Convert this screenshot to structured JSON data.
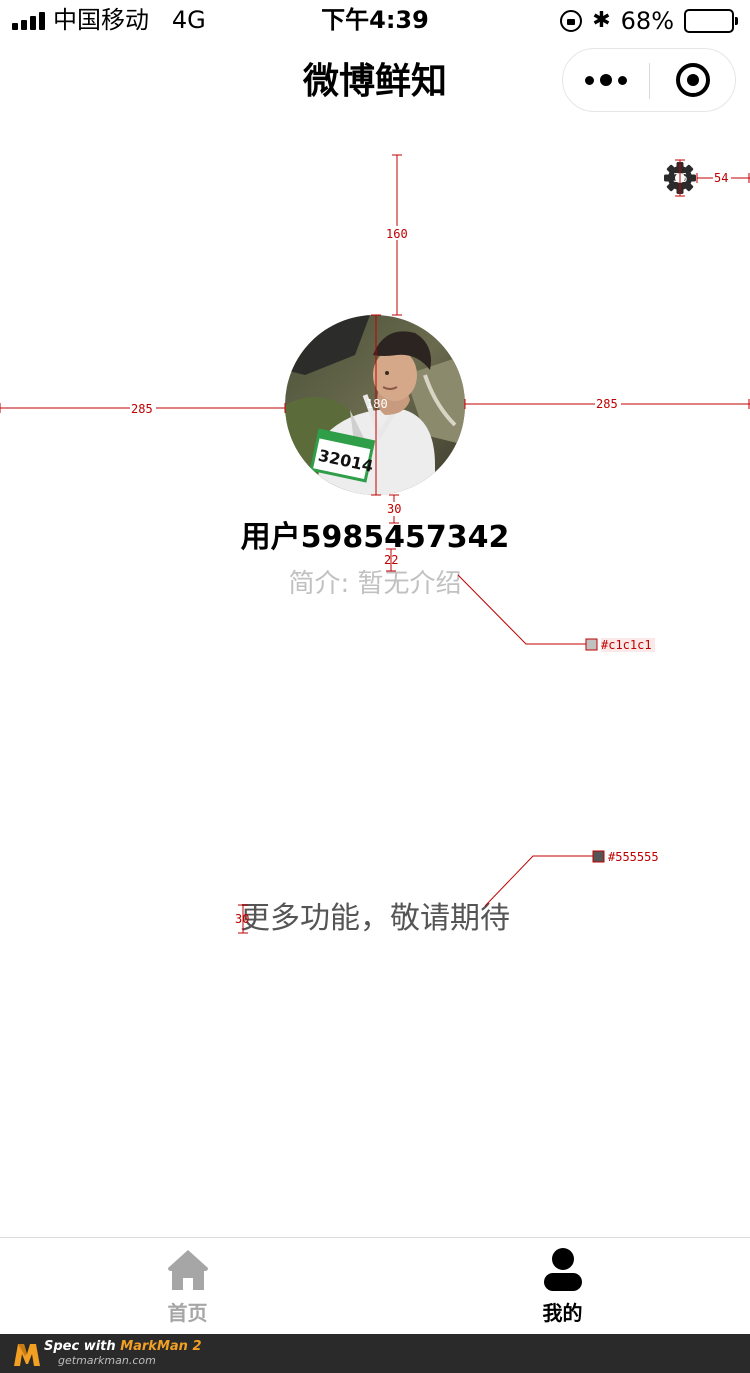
{
  "status_bar": {
    "carrier": "中国移动",
    "network": "4G",
    "time": "下午4:39",
    "battery_percent": "68%",
    "battery_level": 0.68,
    "icons": [
      "signal-icon",
      "rotation-lock-icon",
      "bluetooth-icon",
      "battery-icon"
    ]
  },
  "nav": {
    "title": "微博鲜知",
    "capsule_icons": [
      "more-icon",
      "close-miniprogram-icon"
    ]
  },
  "profile": {
    "username": "用户5985457342",
    "intro": "简介: 暂无介绍",
    "settings_icon": "gear-icon",
    "avatar": "user-avatar-photo",
    "intro_color": "#c1c1c1"
  },
  "main": {
    "more_features": "更多功能，敬请期待",
    "text_color": "#555555"
  },
  "spec": {
    "measurements": {
      "avatar_top_margin": "160",
      "avatar_size": "180",
      "avatar_side_left": "285",
      "avatar_side_right": "285",
      "avatar_to_name": "30",
      "name_to_intro": "22",
      "gear_size": "36",
      "gear_right": "54",
      "text_size": "30"
    },
    "colors": {
      "intro": "#c1c1c1",
      "more_text": "#555555"
    }
  },
  "tab_bar": {
    "tabs": [
      {
        "label": "首页",
        "icon": "home-icon",
        "active": false
      },
      {
        "label": "我的",
        "icon": "user-icon",
        "active": true
      }
    ]
  },
  "footer": {
    "line1_prefix": "Spec with ",
    "line1_brand": "MarkMan 2",
    "line2": "getmarkman.com"
  }
}
